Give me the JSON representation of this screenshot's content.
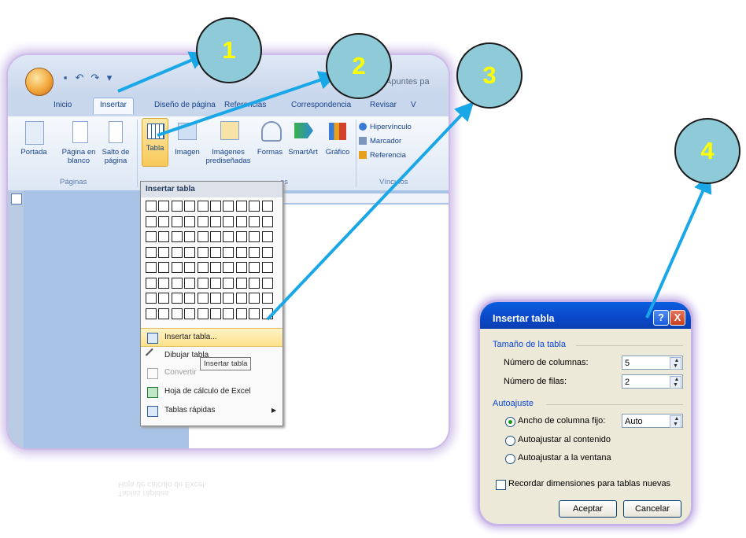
{
  "word": {
    "title": "Apuntes pa",
    "tabs": [
      "Inicio",
      "Insertar",
      "Diseño de página",
      "Referencias",
      "Correspondencia",
      "Revisar",
      "V"
    ],
    "ribbon": {
      "portada": "Portada",
      "pagina_en_blanco": "Página en blanco",
      "salto_de_pagina": "Salto de página",
      "group_paginas": "Páginas",
      "tabla": "Tabla",
      "imagen": "Imagen",
      "imagenes_prediseñadas": "Imágenes prediseñadas",
      "formas": "Formas",
      "smartart": "SmartArt",
      "grafico": "Gráfico",
      "group_ilustraciones": "es",
      "hipervinculo": "Hipervínculo",
      "marcador": "Marcador",
      "referencia": "Referencia",
      "group_vinculos": "Vínculos"
    },
    "ruler_text": "· 1 · 2 · ı · 3 · ı · 4 · ı · 5 · ı · 6 · ı ·",
    "dropdown": {
      "header": "Insertar tabla",
      "items": [
        "Insertar tabla...",
        "Dibujar tabla",
        "Convertir",
        "Hoja de cálculo de Excel",
        "Tablas rápidas"
      ],
      "tooltip": "Insertar tabla"
    }
  },
  "dialog": {
    "title": "Insertar tabla",
    "help": "?",
    "close": "X",
    "section_size": "Tamaño de la tabla",
    "columns_label": "Número de columnas:",
    "columns_value": "5",
    "rows_label": "Número de filas:",
    "rows_value": "2",
    "section_autofit": "Autoajuste",
    "opt_fixed": "Ancho de columna fijo:",
    "fixed_value": "Auto",
    "opt_content": "Autoajustar al contenido",
    "opt_window": "Autoajustar a la ventana",
    "remember": "Recordar dimensiones para tablas nuevas",
    "accept": "Aceptar",
    "cancel": "Cancelar"
  },
  "steps": [
    "1",
    "2",
    "3",
    "4"
  ],
  "colors": {
    "step_fill": "#8ecad8",
    "step_text": "#ffff00",
    "arrow": "#1aa7e8"
  }
}
